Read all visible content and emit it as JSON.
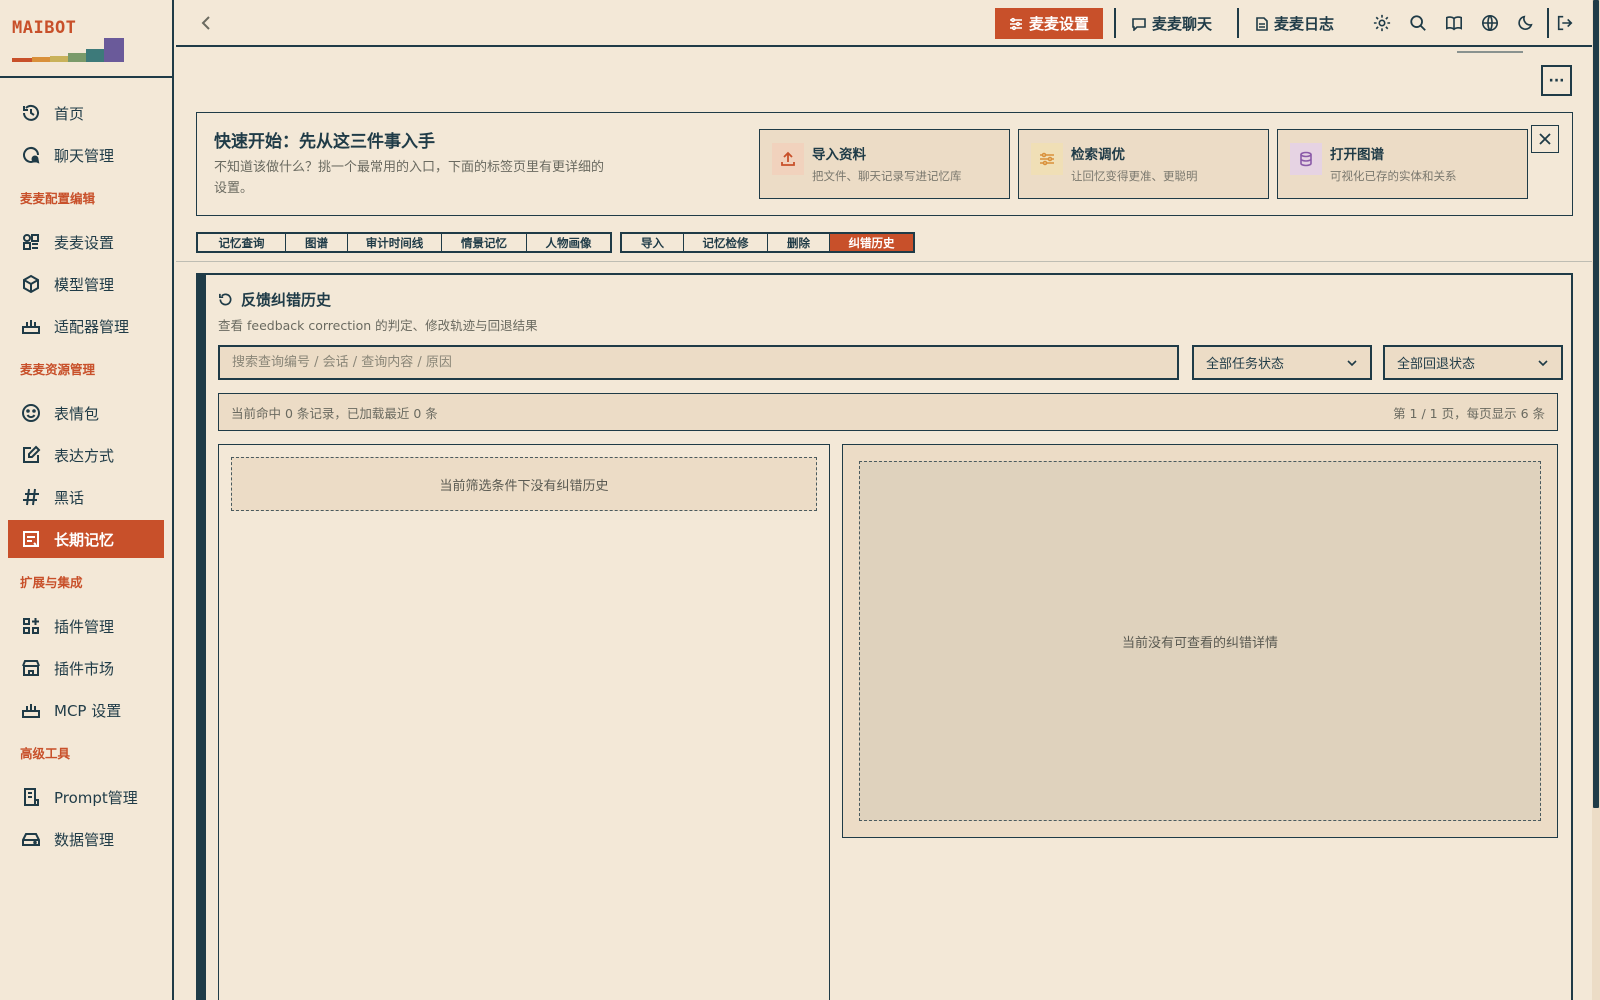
{
  "brand": {
    "name": "MAIBOT",
    "colors": {
      "accent": "#c8502a",
      "ink": "#1f3b47",
      "background": "#f3e8d7",
      "card": "#ecdcc6"
    }
  },
  "sidebar": {
    "items": [
      {
        "label": "首页",
        "icon": "history-home-icon"
      },
      {
        "label": "聊天管理",
        "icon": "chat-manage-icon"
      },
      {
        "section": "麦麦配置编辑"
      },
      {
        "label": "麦麦设置",
        "icon": "settings-grid-icon"
      },
      {
        "label": "模型管理",
        "icon": "cube-icon"
      },
      {
        "label": "适配器管理",
        "icon": "router-icon"
      },
      {
        "section": "麦麦资源管理"
      },
      {
        "label": "表情包",
        "icon": "smile-icon"
      },
      {
        "label": "表达方式",
        "icon": "edit-note-icon"
      },
      {
        "label": "黑话",
        "icon": "hash-icon"
      },
      {
        "label": "长期记忆",
        "icon": "memory-icon",
        "active": true
      },
      {
        "section": "扩展与集成"
      },
      {
        "label": "插件管理",
        "icon": "plugin-grid-icon"
      },
      {
        "label": "插件市场",
        "icon": "store-icon"
      },
      {
        "label": "MCP 设置",
        "icon": "router-icon"
      },
      {
        "section": "高级工具"
      },
      {
        "label": "Prompt管理",
        "icon": "prompt-icon"
      },
      {
        "label": "数据管理",
        "icon": "drive-icon"
      }
    ]
  },
  "topbar": {
    "tabs": [
      {
        "label": "麦麦设置",
        "active": true
      },
      {
        "label": "麦麦聊天"
      },
      {
        "label": "麦麦日志"
      }
    ],
    "more_label": "···"
  },
  "quickstart": {
    "title": "快速开始：先从这三件事入手",
    "desc": "不知道该做什么？挑一个最常用的入口，下面的标签页里有更详细的设置。",
    "cards": [
      {
        "title": "导入资料",
        "desc": "把文件、聊天记录写进记忆库",
        "icon": "upload-icon"
      },
      {
        "title": "检索调优",
        "desc": "让回忆变得更准、更聪明",
        "icon": "sliders-icon"
      },
      {
        "title": "打开图谱",
        "desc": "可视化已存的实体和关系",
        "icon": "database-icon"
      }
    ]
  },
  "subtabs": {
    "group1": [
      "记忆查询",
      "图谱",
      "审计时间线",
      "情景记忆",
      "人物画像"
    ],
    "group2": [
      "导入",
      "记忆检修",
      "删除",
      "纠错历史"
    ],
    "active": "纠错历史"
  },
  "panel": {
    "title": "反馈纠错历史",
    "subtitle": "查看 feedback correction 的判定、修改轨迹与回退结果",
    "search_placeholder": "搜索查询编号 / 会话 / 查询内容 / 原因",
    "filter_task": "全部任务状态",
    "filter_rollback": "全部回退状态",
    "info_left": "当前命中 0 条记录，已加载最近 0 条",
    "info_right": "第 1 / 1 页，每页显示 6 条",
    "empty_list": "当前筛选条件下没有纠错历史",
    "empty_detail": "当前没有可查看的纠错详情"
  }
}
